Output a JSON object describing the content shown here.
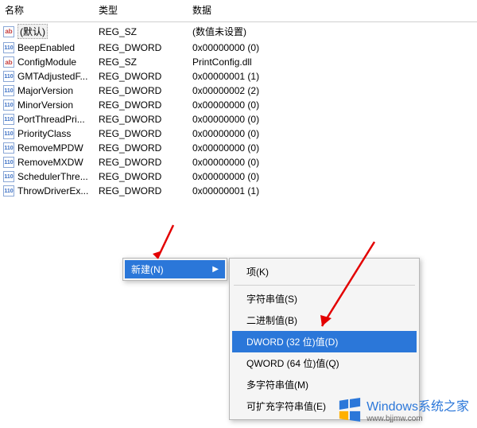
{
  "headers": {
    "name": "名称",
    "type": "类型",
    "data": "数据"
  },
  "rows": [
    {
      "icon": "sz",
      "name": "(默认)",
      "type": "REG_SZ",
      "data": "(数值未设置)",
      "selected": true
    },
    {
      "icon": "dword",
      "name": "BeepEnabled",
      "type": "REG_DWORD",
      "data": "0x00000000 (0)"
    },
    {
      "icon": "sz",
      "name": "ConfigModule",
      "type": "REG_SZ",
      "data": "PrintConfig.dll"
    },
    {
      "icon": "dword",
      "name": "GMTAdjustedF...",
      "type": "REG_DWORD",
      "data": "0x00000001 (1)"
    },
    {
      "icon": "dword",
      "name": "MajorVersion",
      "type": "REG_DWORD",
      "data": "0x00000002 (2)"
    },
    {
      "icon": "dword",
      "name": "MinorVersion",
      "type": "REG_DWORD",
      "data": "0x00000000 (0)"
    },
    {
      "icon": "dword",
      "name": "PortThreadPri...",
      "type": "REG_DWORD",
      "data": "0x00000000 (0)"
    },
    {
      "icon": "dword",
      "name": "PriorityClass",
      "type": "REG_DWORD",
      "data": "0x00000000 (0)"
    },
    {
      "icon": "dword",
      "name": "RemoveMPDW",
      "type": "REG_DWORD",
      "data": "0x00000000 (0)"
    },
    {
      "icon": "dword",
      "name": "RemoveMXDW",
      "type": "REG_DWORD",
      "data": "0x00000000 (0)"
    },
    {
      "icon": "dword",
      "name": "SchedulerThre...",
      "type": "REG_DWORD",
      "data": "0x00000000 (0)"
    },
    {
      "icon": "dword",
      "name": "ThrowDriverEx...",
      "type": "REG_DWORD",
      "data": "0x00000001 (1)"
    }
  ],
  "parent_menu": {
    "new": "新建(N)"
  },
  "sub_menu": {
    "key": "项(K)",
    "string": "字符串值(S)",
    "binary": "二进制值(B)",
    "dword": "DWORD (32 位)值(D)",
    "qword": "QWORD (64 位)值(Q)",
    "multi": "多字符串值(M)",
    "expand": "可扩充字符串值(E)"
  },
  "watermark": {
    "main": "Windows系统之家",
    "sub": "www.bjjmw.com"
  }
}
